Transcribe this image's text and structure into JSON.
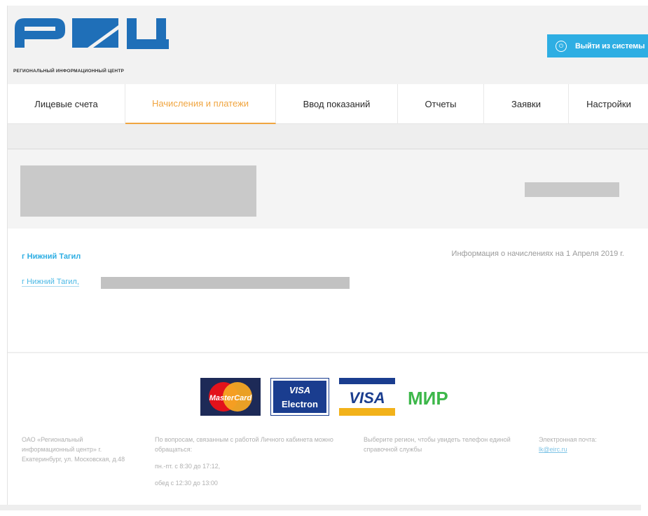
{
  "header": {
    "logo_tagline": "РЕГИОНАЛЬНЫЙ ИНФОРМАЦИОННЫЙ ЦЕНТР",
    "logout_label": "Выйти из системы",
    "logout_icon": "logout-icon"
  },
  "tabs": [
    {
      "label": "Лицевые счета",
      "active": false
    },
    {
      "label": "Начисления и платежи",
      "active": true
    },
    {
      "label": "Ввод показаний",
      "active": false
    },
    {
      "label": "Отчеты",
      "active": false
    },
    {
      "label": "Заявки",
      "active": false
    },
    {
      "label": "Настройки",
      "active": false
    }
  ],
  "info": {
    "city_title": "г Нижний Тагил",
    "charges_info": "Информация о начислениях на 1 Апреля 2019 г.",
    "city_link": "г Нижний Тагил,"
  },
  "payment_logos": [
    "MasterCard",
    "VISA Electron",
    "VISA",
    "МИР"
  ],
  "footer": {
    "company": "ОАО «Региональный информационный центр» г. Екатеринбург, ул. Московская, д.48",
    "questions": "По вопросам, связанным с работой Личного кабинета можно обращаться:",
    "hours": "пн.-пт. с 8:30 до 17:12,",
    "lunch": "обед с 12:30 до 13:00",
    "region_hint": "Выберите регион, чтобы увидеть телефон единой справочной службы",
    "email_label": "Электронная почта:",
    "email": "lk@eirc.ru"
  },
  "colors": {
    "accent_blue": "#2eaee3",
    "active_tab_orange": "#f0a540",
    "logo_blue": "#1f6fb8"
  }
}
